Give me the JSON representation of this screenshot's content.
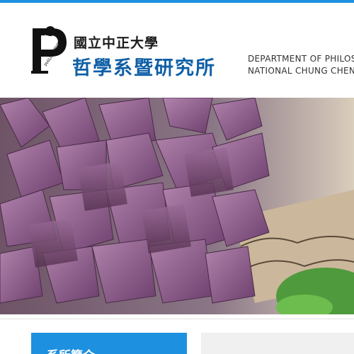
{
  "header": {
    "university_name": "國立中正大學",
    "department_name": "哲學系暨研究所",
    "english_line1": "DEPARTMENT OF PHILOSO",
    "english_line2": "NATIONAL CHUNG CHENG U",
    "logo_text": "PHILOSOPHY"
  },
  "colors": {
    "accent": "#1e90e0",
    "department_title": "#0f5fa6"
  },
  "banner": {
    "subject": "purple oxalis leaves in a planter"
  },
  "sidebar": {
    "title": "系所簡介"
  }
}
